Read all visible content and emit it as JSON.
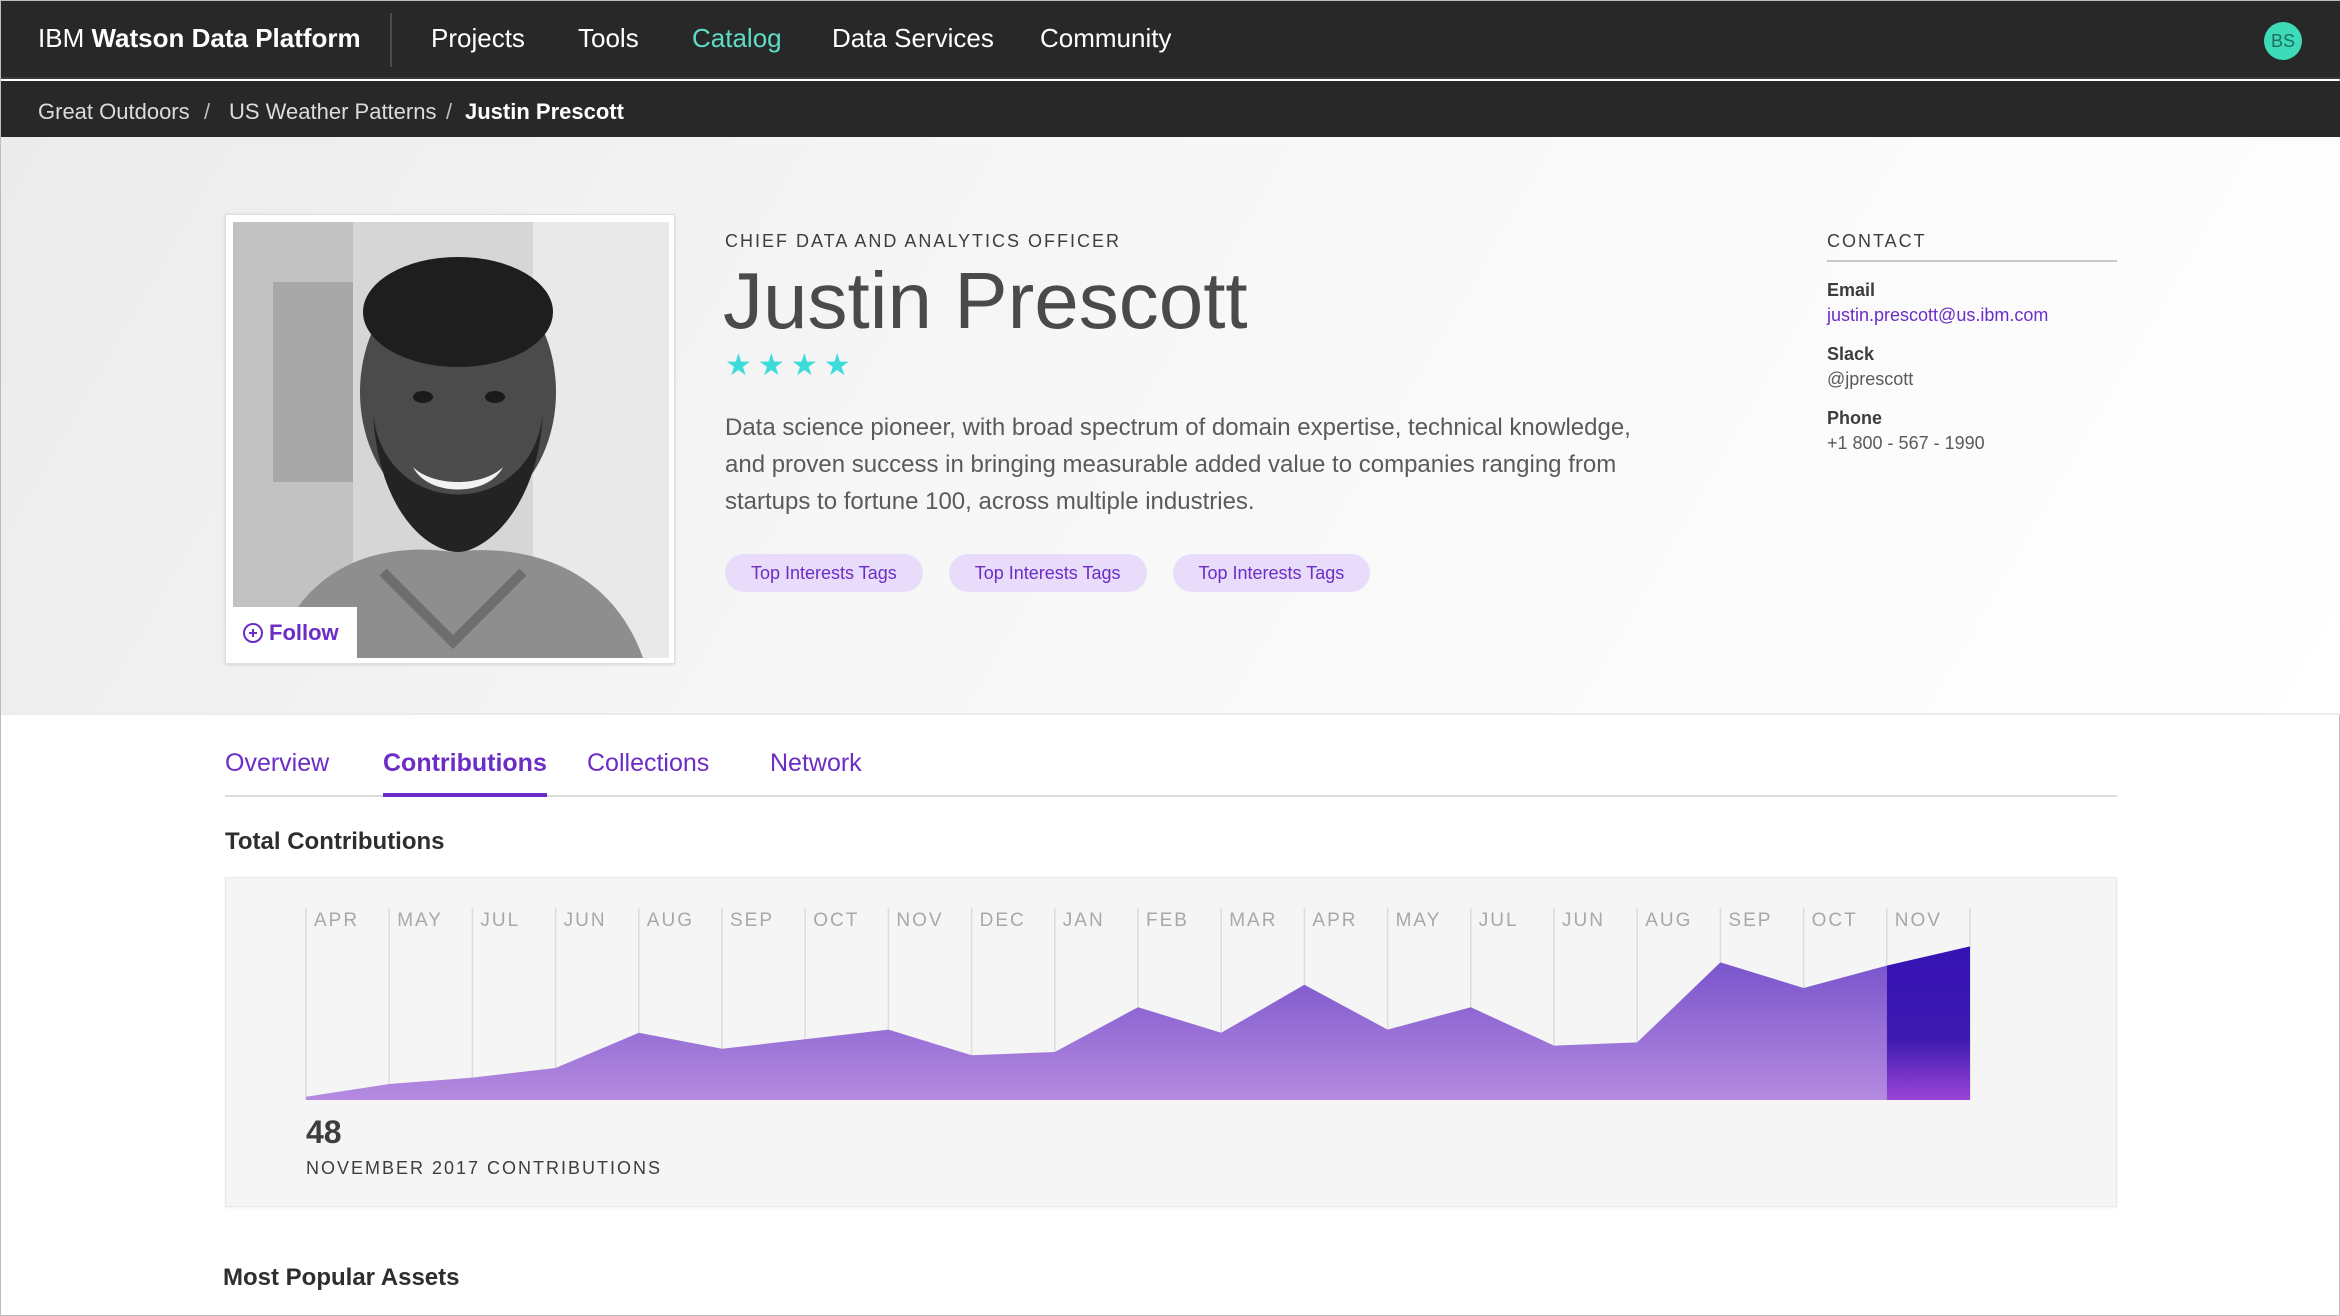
{
  "nav": {
    "brand_prefix": "IBM",
    "brand_name": "Watson Data Platform",
    "items": [
      "Projects",
      "Tools",
      "Catalog",
      "Data Services",
      "Community"
    ],
    "active": "Catalog",
    "user_initials": "BS"
  },
  "breadcrumb": {
    "items": [
      "Great Outdoors",
      "US Weather Patterns",
      "Justin Prescott"
    ],
    "separator": "/"
  },
  "profile": {
    "job_title": "CHIEF DATA AND ANALYTICS OFFICER",
    "name": "Justin Prescott",
    "rating": 4,
    "bio": "Data science pioneer,  with broad spectrum of domain expertise, technical knowledge, and proven success in bringing measurable added value to companies ranging from startups to fortune 100, across multiple industries.",
    "follow_label": "Follow",
    "tags": [
      "Top Interests Tags",
      "Top Interests Tags",
      "Top Interests Tags"
    ]
  },
  "contact": {
    "heading": "CONTACT",
    "email_label": "Email",
    "email": "justin.prescott@us.ibm.com",
    "slack_label": "Slack",
    "slack": "@jprescott",
    "phone_label": "Phone",
    "phone": "+1 800 - 567 - 1990"
  },
  "tabs": {
    "items": [
      "Overview",
      "Contributions",
      "Collections",
      "Network"
    ],
    "active": "Contributions"
  },
  "sections": {
    "total_contributions": "Total Contributions",
    "most_popular": "Most Popular Assets"
  },
  "chart_data": {
    "type": "area",
    "title": "Total Contributions",
    "categories": [
      "APR",
      "MAY",
      "JUL",
      "JUN",
      "AUG",
      "SEP",
      "OCT",
      "NOV",
      "DEC",
      "JAN",
      "FEB",
      "MAR",
      "APR",
      "MAY",
      "JUL",
      "JUN",
      "AUG",
      "SEP",
      "OCT",
      "NOV"
    ],
    "values": [
      1,
      5,
      7,
      10,
      21,
      16,
      19,
      22,
      14,
      15,
      29,
      21,
      36,
      22,
      29,
      17,
      18,
      43,
      35,
      42,
      48
    ],
    "ylim": [
      0,
      60
    ],
    "highlight_last": true,
    "colors": {
      "area": "#8a63d2",
      "highlight": "#3d1ab0",
      "highlight_bottom": "#9b45d6",
      "grid": "#dcdcdc",
      "tick": "#a8a8a8"
    },
    "summary_value": "48",
    "summary_label": "NOVEMBER 2017 CONTRIBUTIONS"
  }
}
